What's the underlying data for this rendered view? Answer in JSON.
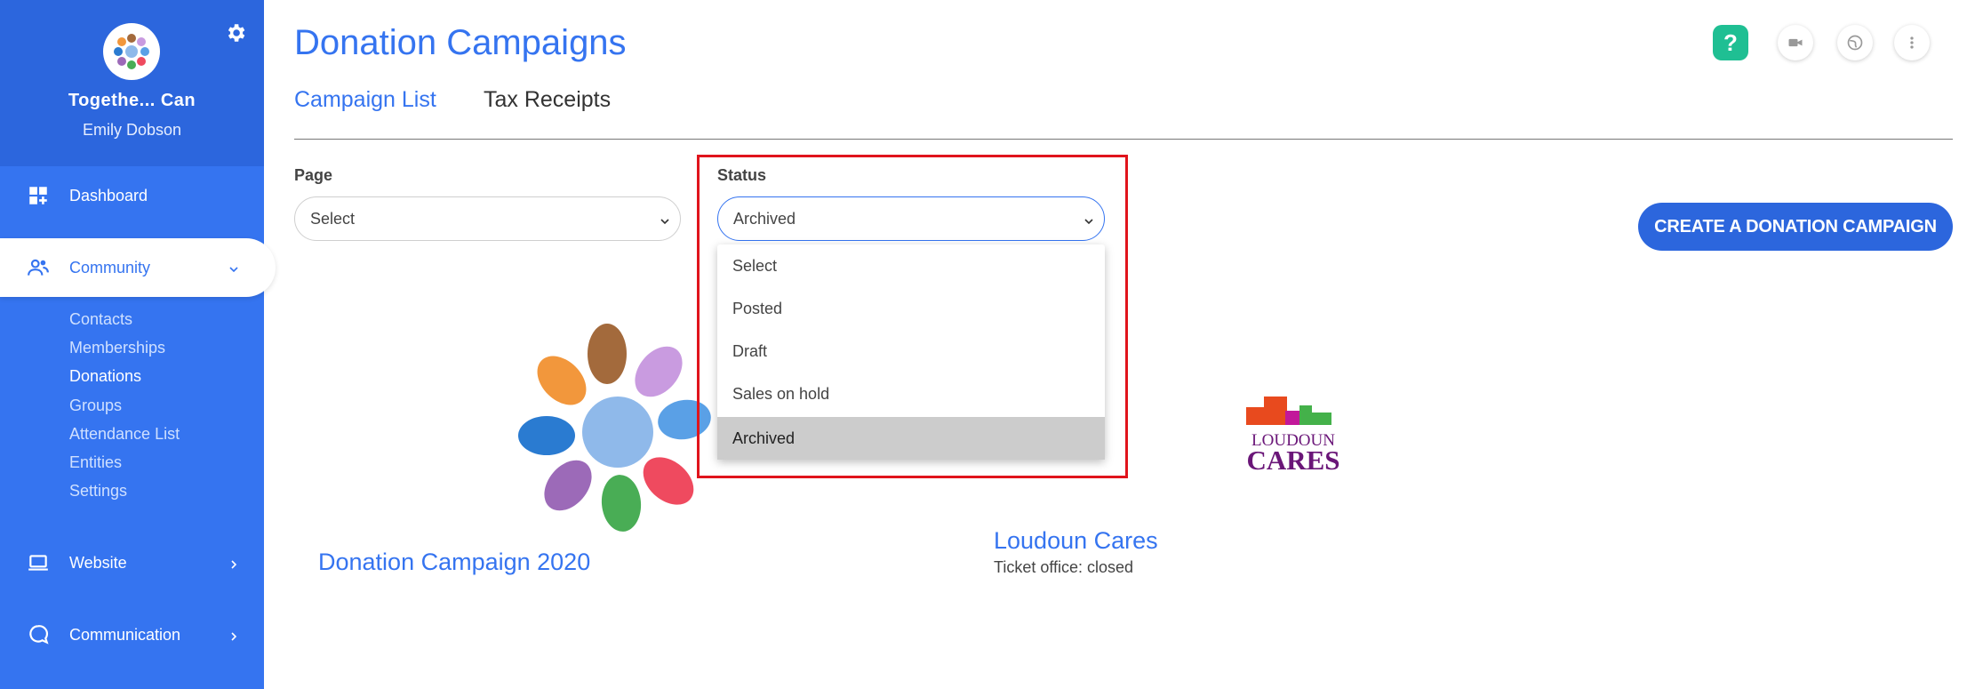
{
  "sidebar": {
    "org_name": "Togethe... Can",
    "user_name": "Emily Dobson",
    "nav": {
      "dashboard": "Dashboard",
      "community": "Community",
      "website": "Website",
      "communication": "Communication"
    },
    "community_subitems": [
      "Contacts",
      "Memberships",
      "Donations",
      "Groups",
      "Attendance List",
      "Entities",
      "Settings"
    ],
    "current_subitem": "Donations"
  },
  "page": {
    "title": "Donation Campaigns",
    "tabs": [
      "Campaign List",
      "Tax Receipts"
    ],
    "active_tab": "Campaign List"
  },
  "filters": {
    "page_label": "Page",
    "page_value": "Select",
    "status_label": "Status",
    "status_value": "Archived",
    "status_options": [
      "Select",
      "Posted",
      "Draft",
      "Sales on hold",
      "Archived"
    ]
  },
  "create_button": "CREATE A DONATION CAMPAIGN",
  "campaigns": [
    {
      "title": "Donation Campaign 2020",
      "subtitle": ""
    },
    {
      "title": "Loudoun Cares",
      "subtitle": "Ticket office: closed"
    }
  ],
  "logos": {
    "loudoun_line1": "LOUDOUN",
    "loudoun_line2": "CARES"
  },
  "top_icons": [
    "help-icon",
    "video-icon",
    "globe-icon",
    "more-vertical-icon"
  ],
  "colors": {
    "accent": "#3574f0",
    "sidebar": "#3574f0",
    "help": "#1fbf93",
    "highlight": "#e0141c"
  }
}
